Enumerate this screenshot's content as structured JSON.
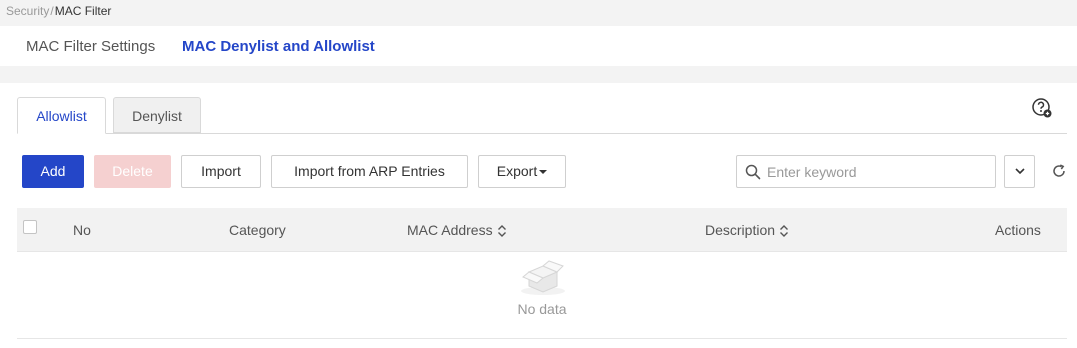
{
  "breadcrumb": {
    "parent": "Security",
    "separator": "/",
    "current": "MAC Filter"
  },
  "nav": {
    "tabs": [
      {
        "label": "MAC Filter Settings"
      },
      {
        "label": "MAC Denylist and Allowlist",
        "active": true
      }
    ]
  },
  "subtabs": {
    "allowlist": "Allowlist",
    "denylist": "Denylist",
    "active": "Allowlist"
  },
  "toolbar": {
    "add": "Add",
    "delete": "Delete",
    "import": "Import",
    "import_arp": "Import from ARP Entries",
    "export": "Export"
  },
  "search": {
    "placeholder": "Enter keyword",
    "value": ""
  },
  "table": {
    "columns": [
      "No",
      "Category",
      "MAC Address",
      "Description",
      "Actions"
    ],
    "rows": [],
    "empty_text": "No data"
  },
  "colors": {
    "accent": "#2446c8",
    "delete_disabled": "#f5d0d0"
  },
  "icons": {
    "help": "help-question-icon",
    "search": "search-icon",
    "dropdown": "chevron-down-icon",
    "refresh": "refresh-icon",
    "sort": "sort-icon",
    "empty": "empty-box-icon"
  }
}
